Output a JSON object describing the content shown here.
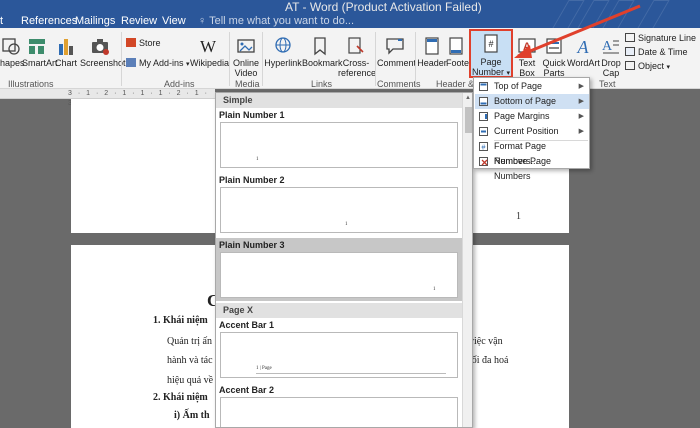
{
  "window": {
    "title": "AT - Word (Product Activation Failed)"
  },
  "tabs": [
    {
      "label": "t"
    },
    {
      "label": "References"
    },
    {
      "label": "Mailings"
    },
    {
      "label": "Review"
    },
    {
      "label": "View"
    }
  ],
  "tell_me": {
    "placeholder": "Tell me what you want to do..."
  },
  "ribbon": {
    "illustrations": {
      "shapes": "hapes",
      "smartart": "SmartArt",
      "chart": "Chart",
      "screenshot": "Screenshot",
      "group_label": "Illustrations"
    },
    "addins": {
      "store": "Store",
      "my_addins": "My Add-ins",
      "wikipedia": "Wikipedia",
      "group_label": "Add-ins"
    },
    "media": {
      "online_video_1": "Online",
      "online_video_2": "Video",
      "group_label": "Media"
    },
    "links": {
      "hyperlink": "Hyperlink",
      "bookmark": "Bookmark",
      "cross_ref_1": "Cross-",
      "cross_ref_2": "reference",
      "group_label": "Links"
    },
    "comments": {
      "comment": "Comment",
      "group_label": "Comments"
    },
    "header_footer": {
      "header": "Header",
      "footer": "Foote",
      "page_number_1": "Page",
      "page_number_2": "Number",
      "group_label": "Header & F"
    },
    "text": {
      "text_box_1": "Text",
      "text_box_2": "Box",
      "quick_parts_1": "Quick",
      "quick_parts_2": "Parts",
      "wordart": "WordArt",
      "drop_cap_1": "Drop",
      "drop_cap_2": "Cap",
      "signature_line": "Signature Line",
      "date_time": "Date & Time",
      "object": "Object",
      "group_label": "Text"
    }
  },
  "ruler": {
    "text": "3 · 1 · 2 · 1 · 1 · 1 · 2 · 1 · 3"
  },
  "document": {
    "page_number": "1",
    "heading_fragment": "C",
    "lines": [
      "1.   Khái niệm",
      "Quản trị ấn",
      "hành và tác",
      "hiệu quả về",
      "2.   Khái niệm",
      "i)   Ấm th"
    ],
    "right_fragments": [
      "việc vận",
      "tối đa hoá"
    ]
  },
  "gallery": {
    "sections": [
      {
        "title": "Simple"
      },
      {
        "title": "Page X"
      }
    ],
    "items": [
      {
        "label": "Plain Number 1",
        "num": "1"
      },
      {
        "label": "Plain Number 2",
        "num": "1"
      },
      {
        "label": "Plain Number 3",
        "num": "1"
      },
      {
        "label": "Accent Bar 1",
        "num": "1 | Page"
      },
      {
        "label": "Accent Bar 2",
        "num": ""
      }
    ]
  },
  "submenu": {
    "items": [
      {
        "label": "Top of Page",
        "arrow": "▶"
      },
      {
        "label": "Bottom of Page",
        "arrow": "▶"
      },
      {
        "label": "Page Margins",
        "arrow": "▶"
      },
      {
        "label": "Current Position",
        "arrow": "▶"
      },
      {
        "label": "Format Page Numbers..."
      },
      {
        "label": "Remove Page Numbers"
      }
    ]
  },
  "colors": {
    "word_blue": "#2b579a",
    "highlight_red": "#e0402c",
    "selected_menu": "#cfe0f3"
  }
}
